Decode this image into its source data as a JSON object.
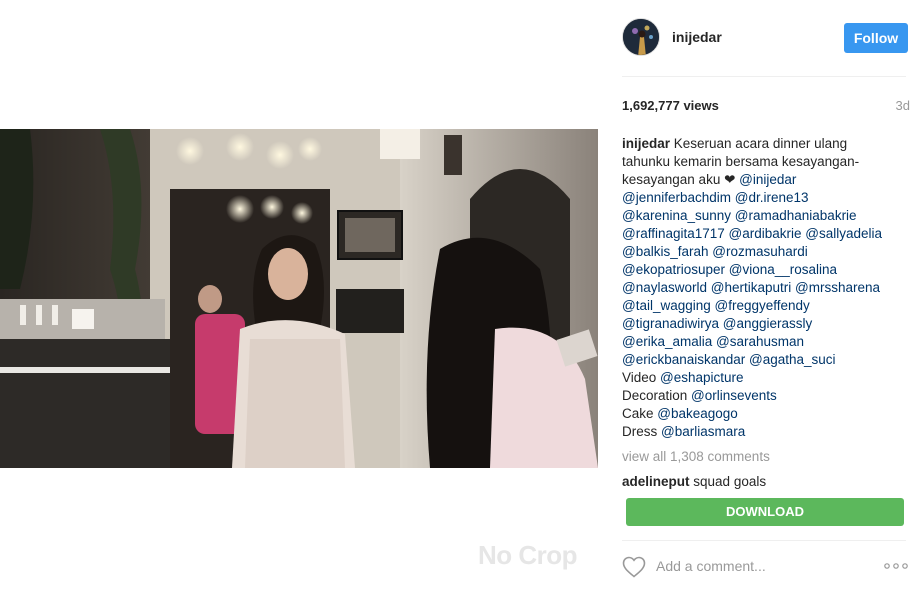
{
  "post": {
    "username": "inijedar",
    "follow_label": "Follow",
    "views": "1,692,777 views",
    "time": "3d",
    "caption_lines": [
      {
        "author": "inijedar",
        "text": " Keseruan acara dinner ulang"
      },
      {
        "text": "tahunku kemarin bersama kesayangan-"
      },
      {
        "text": "kesayangan aku ❤ ",
        "mention": "@inijedar"
      },
      {
        "mention": "@jenniferbachdim",
        "mention2": "@dr.irene13"
      },
      {
        "mention": "@karenina_sunny",
        "mention2": "@ramadhaniabakrie"
      },
      {
        "mention": "@raffinagita1717",
        "mention2": "@ardibakrie",
        "mention3": "@sallyadelia"
      },
      {
        "mention": "@balkis_farah",
        "mention2": "@rozmasuhardi"
      },
      {
        "mention": "@ekopatriosuper",
        "mention2": "@viona__rosalina"
      },
      {
        "mention": "@naylasworld",
        "mention2": "@hertikaputri",
        "mention3": "@mrssharena"
      },
      {
        "mention": "@tail_wagging",
        "mention2": "@freggyeffendy"
      },
      {
        "mention": "@tigranadiwirya",
        "mention2": "@anggierassly"
      },
      {
        "mention": "@erika_amalia",
        "mention2": "@sarahusman"
      },
      {
        "mention": "@erickbanaiskandar",
        "mention2": "@agatha_suci"
      },
      {
        "text": "Video ",
        "mention": "@eshapicture"
      },
      {
        "text": "Decoration ",
        "mention": "@orlinsevents"
      },
      {
        "text": "Cake ",
        "mention": "@bakeagogo"
      },
      {
        "text": "Dress ",
        "mention": "@barliasmara"
      }
    ],
    "view_comments": "view all 1,308 comments",
    "comment": {
      "author": "adelineput",
      "text": "squad goals"
    },
    "download_label": "DOWNLOAD",
    "comment_placeholder": "Add a comment...",
    "watermark": "No Crop"
  },
  "colors": {
    "follow": "#3897f0",
    "download": "#5cb85c",
    "link": "#003569",
    "muted": "#999999"
  },
  "icons": {
    "like": "heart-outline-icon",
    "more": "ellipsis-icon"
  }
}
